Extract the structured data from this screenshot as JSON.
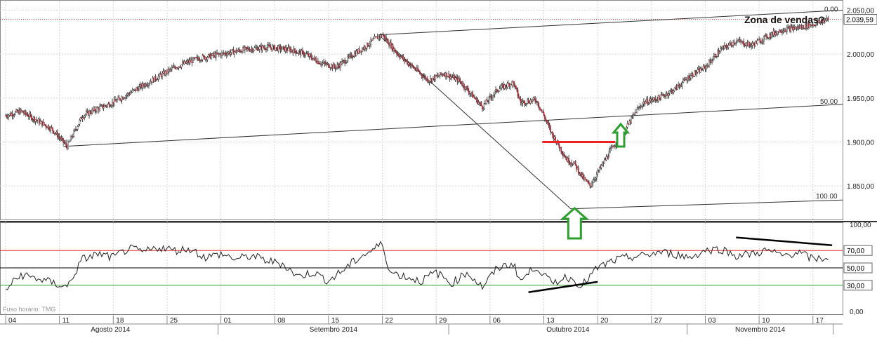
{
  "chart_data": [
    {
      "type": "candlestick",
      "title": "",
      "annotation": "Zona de vendas?",
      "last_price_label": "2.039,59",
      "y_axis": {
        "ylim": [
          1815,
          2060
        ],
        "ticks": [
          {
            "value": 1850,
            "label": "1.850,00"
          },
          {
            "value": 1900,
            "label": "1.900,00"
          },
          {
            "value": 1950,
            "label": "1.950,00"
          },
          {
            "value": 2000,
            "label": "2.000,00"
          },
          {
            "value": 2050,
            "label": "2.050,00"
          }
        ],
        "grid": true
      },
      "fibonacci_labels": [
        "0.00",
        "50.00",
        "100.00"
      ],
      "close_path": [
        {
          "d": 0,
          "close": 1930
        },
        {
          "d": 2,
          "close": 1935
        },
        {
          "d": 4,
          "close": 1925
        },
        {
          "d": 6,
          "close": 1915
        },
        {
          "d": 7,
          "close": 1905
        },
        {
          "d": 8,
          "close": 1895
        },
        {
          "d": 10,
          "close": 1930
        },
        {
          "d": 12,
          "close": 1938
        },
        {
          "d": 14,
          "close": 1945
        },
        {
          "d": 16,
          "close": 1955
        },
        {
          "d": 18,
          "close": 1965
        },
        {
          "d": 20,
          "close": 1975
        },
        {
          "d": 22,
          "close": 1985
        },
        {
          "d": 25,
          "close": 1995
        },
        {
          "d": 28,
          "close": 2000
        },
        {
          "d": 31,
          "close": 2005
        },
        {
          "d": 34,
          "close": 2008
        },
        {
          "d": 37,
          "close": 2005
        },
        {
          "d": 39,
          "close": 2000
        },
        {
          "d": 41,
          "close": 1990
        },
        {
          "d": 43,
          "close": 1985
        },
        {
          "d": 45,
          "close": 1998
        },
        {
          "d": 47,
          "close": 2010
        },
        {
          "d": 48,
          "close": 2017
        },
        {
          "d": 49,
          "close": 2022
        },
        {
          "d": 51,
          "close": 2000
        },
        {
          "d": 53,
          "close": 1985
        },
        {
          "d": 55,
          "close": 1970
        },
        {
          "d": 57,
          "close": 1978
        },
        {
          "d": 59,
          "close": 1970
        },
        {
          "d": 61,
          "close": 1950
        },
        {
          "d": 62,
          "close": 1940
        },
        {
          "d": 64,
          "close": 1960
        },
        {
          "d": 66,
          "close": 1968
        },
        {
          "d": 67,
          "close": 1945
        },
        {
          "d": 69,
          "close": 1948
        },
        {
          "d": 70,
          "close": 1930
        },
        {
          "d": 71,
          "close": 1910
        },
        {
          "d": 72,
          "close": 1895
        },
        {
          "d": 73,
          "close": 1880
        },
        {
          "d": 74,
          "close": 1875
        },
        {
          "d": 75,
          "close": 1860
        },
        {
          "d": 76,
          "close": 1850
        },
        {
          "d": 77,
          "close": 1865
        },
        {
          "d": 78,
          "close": 1880
        },
        {
          "d": 79,
          "close": 1895
        },
        {
          "d": 80,
          "close": 1905
        },
        {
          "d": 81,
          "close": 1920
        },
        {
          "d": 82,
          "close": 1935
        },
        {
          "d": 83,
          "close": 1945
        },
        {
          "d": 85,
          "close": 1950
        },
        {
          "d": 87,
          "close": 1960
        },
        {
          "d": 89,
          "close": 1975
        },
        {
          "d": 91,
          "close": 1985
        },
        {
          "d": 93,
          "close": 2005
        },
        {
          "d": 95,
          "close": 2015
        },
        {
          "d": 97,
          "close": 2010
        },
        {
          "d": 99,
          "close": 2020
        },
        {
          "d": 101,
          "close": 2028
        },
        {
          "d": 103,
          "close": 2030
        },
        {
          "d": 105,
          "close": 2034
        },
        {
          "d": 107,
          "close": 2039.59
        }
      ]
    },
    {
      "type": "line",
      "title": "",
      "y_axis": {
        "ylim": [
          0,
          100
        ],
        "ticks": [
          {
            "value": 0,
            "label": "0,00"
          },
          {
            "value": 100,
            "label": "100,00"
          }
        ]
      },
      "reference_lines": [
        {
          "value": 70,
          "label": "70,00",
          "color": "#e03030"
        },
        {
          "value": 50,
          "label": "50,00",
          "color": "#000000"
        },
        {
          "value": 30,
          "label": "30,00",
          "color": "#2aa02a"
        }
      ],
      "rsi_path": [
        {
          "d": 0,
          "v": 25
        },
        {
          "d": 2,
          "v": 42
        },
        {
          "d": 4,
          "v": 38
        },
        {
          "d": 6,
          "v": 33
        },
        {
          "d": 8,
          "v": 28
        },
        {
          "d": 10,
          "v": 60
        },
        {
          "d": 12,
          "v": 66
        },
        {
          "d": 14,
          "v": 62
        },
        {
          "d": 16,
          "v": 72
        },
        {
          "d": 18,
          "v": 68
        },
        {
          "d": 20,
          "v": 74
        },
        {
          "d": 22,
          "v": 70
        },
        {
          "d": 24,
          "v": 72
        },
        {
          "d": 26,
          "v": 62
        },
        {
          "d": 28,
          "v": 66
        },
        {
          "d": 30,
          "v": 60
        },
        {
          "d": 32,
          "v": 64
        },
        {
          "d": 34,
          "v": 58
        },
        {
          "d": 36,
          "v": 55
        },
        {
          "d": 38,
          "v": 40
        },
        {
          "d": 40,
          "v": 45
        },
        {
          "d": 42,
          "v": 35
        },
        {
          "d": 44,
          "v": 48
        },
        {
          "d": 46,
          "v": 62
        },
        {
          "d": 48,
          "v": 72
        },
        {
          "d": 49,
          "v": 78
        },
        {
          "d": 50,
          "v": 45
        },
        {
          "d": 52,
          "v": 40
        },
        {
          "d": 54,
          "v": 35
        },
        {
          "d": 56,
          "v": 45
        },
        {
          "d": 58,
          "v": 32
        },
        {
          "d": 60,
          "v": 45
        },
        {
          "d": 62,
          "v": 28
        },
        {
          "d": 64,
          "v": 50
        },
        {
          "d": 66,
          "v": 55
        },
        {
          "d": 67,
          "v": 35
        },
        {
          "d": 69,
          "v": 52
        },
        {
          "d": 71,
          "v": 32
        },
        {
          "d": 73,
          "v": 40
        },
        {
          "d": 75,
          "v": 30
        },
        {
          "d": 77,
          "v": 50
        },
        {
          "d": 79,
          "v": 58
        },
        {
          "d": 81,
          "v": 62
        },
        {
          "d": 83,
          "v": 64
        },
        {
          "d": 85,
          "v": 68
        },
        {
          "d": 87,
          "v": 66
        },
        {
          "d": 89,
          "v": 62
        },
        {
          "d": 91,
          "v": 70
        },
        {
          "d": 93,
          "v": 72
        },
        {
          "d": 95,
          "v": 64
        },
        {
          "d": 97,
          "v": 66
        },
        {
          "d": 99,
          "v": 70
        },
        {
          "d": 101,
          "v": 64
        },
        {
          "d": 103,
          "v": 68
        },
        {
          "d": 105,
          "v": 60
        },
        {
          "d": 107,
          "v": 62
        }
      ]
    }
  ],
  "x_axis": {
    "timezone_label": "Fuso horário: TMG",
    "day_ticks": [
      {
        "d": 0,
        "label": "04"
      },
      {
        "d": 7,
        "label": "11"
      },
      {
        "d": 14,
        "label": "18"
      },
      {
        "d": 21,
        "label": "25"
      },
      {
        "d": 28,
        "label": "01"
      },
      {
        "d": 35,
        "label": "08"
      },
      {
        "d": 42,
        "label": "15"
      },
      {
        "d": 49,
        "label": "22"
      },
      {
        "d": 56,
        "label": "29"
      },
      {
        "d": 63,
        "label": "06"
      },
      {
        "d": 70,
        "label": "13"
      },
      {
        "d": 77,
        "label": "20"
      },
      {
        "d": 84,
        "label": "27"
      },
      {
        "d": 91,
        "label": "03"
      },
      {
        "d": 98,
        "label": "10"
      },
      {
        "d": 105,
        "label": "17"
      }
    ],
    "months": [
      {
        "label": "Agosto 2014",
        "start": 0,
        "end": 28
      },
      {
        "label": "Setembro 2014",
        "start": 28,
        "end": 58
      },
      {
        "label": "Outubro 2014",
        "start": 58,
        "end": 89
      },
      {
        "label": "Novembro 2014",
        "start": 89,
        "end": 108
      }
    ]
  },
  "colors": {
    "up": "#2e8b2e",
    "down": "#b0303a",
    "support_line": "#ee2222",
    "arrow": "#2ca02c",
    "grid": "#d8d8d8"
  }
}
